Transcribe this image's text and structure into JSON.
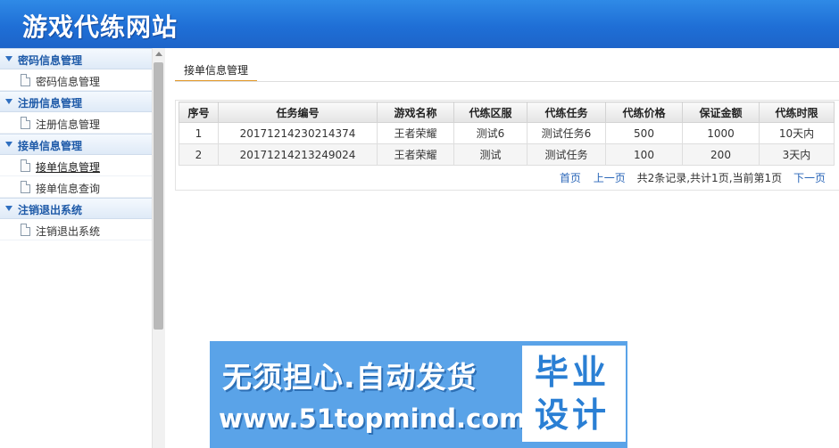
{
  "header": {
    "title": "游戏代练网站"
  },
  "sidebar": {
    "groups": [
      {
        "label": "密码信息管理",
        "items": [
          {
            "label": "密码信息管理"
          }
        ]
      },
      {
        "label": "注册信息管理",
        "items": [
          {
            "label": "注册信息管理"
          }
        ]
      },
      {
        "label": "接单信息管理",
        "items": [
          {
            "label": "接单信息管理"
          },
          {
            "label": "接单信息查询"
          }
        ]
      },
      {
        "label": "注销退出系统",
        "items": [
          {
            "label": "注销退出系统"
          }
        ]
      }
    ]
  },
  "main": {
    "tab_label": "接单信息管理",
    "table": {
      "columns": [
        "序号",
        "任务编号",
        "游戏名称",
        "代练区服",
        "代练任务",
        "代练价格",
        "保证金额",
        "代练时限"
      ],
      "rows": [
        [
          "1",
          "20171214230214374",
          "王者荣耀",
          "测试6",
          "测试任务6",
          "500",
          "1000",
          "10天内"
        ],
        [
          "2",
          "20171214213249024",
          "王者荣耀",
          "测试",
          "测试任务",
          "100",
          "200",
          "3天内"
        ]
      ]
    },
    "pager": {
      "first": "首页",
      "prev": "上一页",
      "summary": "共2条记录,共计1页,当前第1页",
      "next": "下一页"
    }
  },
  "watermark": {
    "line1": "无须担心.自动发货",
    "line2": "www.51topmind.com",
    "box_text": "毕业设计"
  },
  "colors": {
    "header_blue": "#1f6fd6",
    "tab_underline": "#e29a2c",
    "link_blue": "#2a66b8",
    "watermark_blue": "#5aa3e8"
  }
}
